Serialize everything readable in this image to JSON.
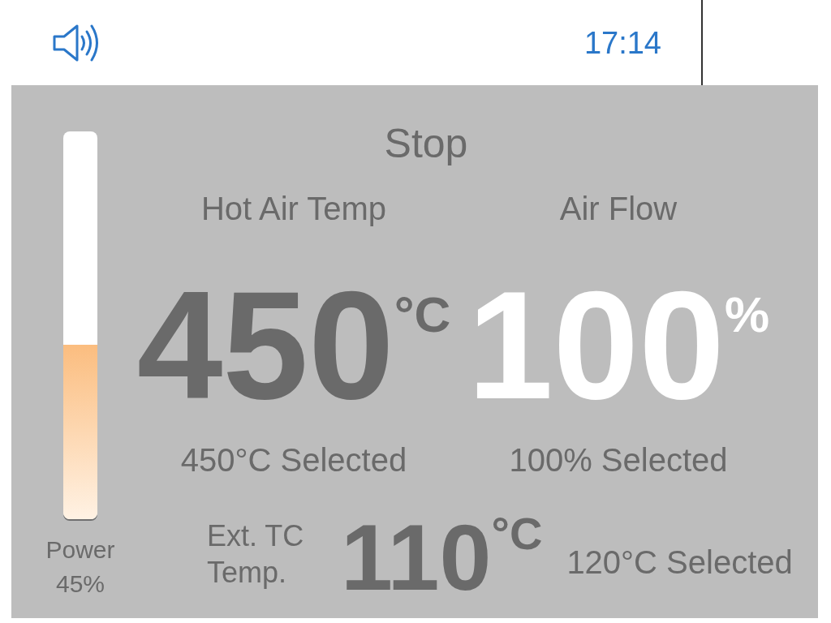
{
  "status_bar": {
    "time": "17:14"
  },
  "mode": "Stop",
  "power": {
    "label": "Power",
    "reading": "45%",
    "level": 0.45
  },
  "readouts": [
    {
      "label": "Hot Air Temp",
      "value": "450",
      "unit": "°C",
      "selected_text": "450°C Selected",
      "active": false
    },
    {
      "label": "Air Flow",
      "value": "100",
      "unit": "%",
      "selected_text": "100% Selected",
      "active": true
    }
  ],
  "external_tc": {
    "label": "Ext. TC Temp.",
    "value": "110",
    "unit": "°C",
    "selected_text": "120°C Selected"
  }
}
